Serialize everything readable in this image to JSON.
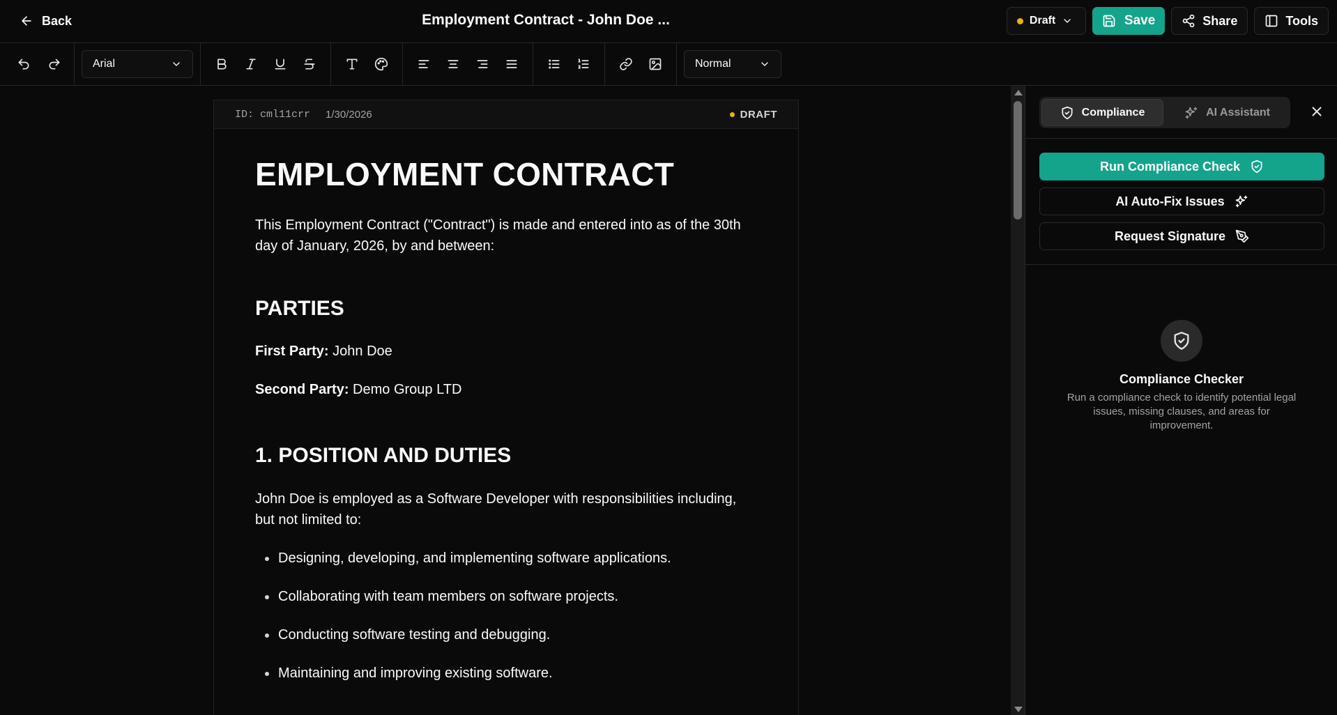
{
  "header": {
    "back_label": "Back",
    "title": "Employment Contract - John Doe ...",
    "status_label": "Draft",
    "save_label": "Save",
    "share_label": "Share",
    "tools_label": "Tools",
    "status_color": "#eab308",
    "accent_color": "#14a38b"
  },
  "toolbar": {
    "font_family": "Arial",
    "block_style": "Normal",
    "icons": [
      "undo-icon",
      "redo-icon",
      "bold-icon",
      "italic-icon",
      "underline-icon",
      "strikethrough-icon",
      "text-type-icon",
      "palette-icon",
      "align-left-icon",
      "align-center-icon",
      "align-right-icon",
      "align-justify-icon",
      "bullet-list-icon",
      "numbered-list-icon",
      "link-icon",
      "image-icon"
    ]
  },
  "document": {
    "id": "ID: cml11crr",
    "date": "1/30/2026",
    "status_badge": "DRAFT",
    "heading": "EMPLOYMENT CONTRACT",
    "intro": "This Employment Contract (\"Contract\") is made and entered into as of the 30th day of January, 2026, by and between:",
    "parties_heading": "PARTIES",
    "first_party_label": "First Party:",
    "first_party_value": " John Doe",
    "second_party_label": "Second Party:",
    "second_party_value": " Demo Group LTD",
    "section1_heading": "1. POSITION AND DUTIES",
    "section1_text": "John Doe is employed as a Software Developer with responsibilities including, but not limited to:",
    "duties": [
      "Designing, developing, and implementing software applications.",
      "Collaborating with team members on software projects.",
      "Conducting software testing and debugging.",
      "Maintaining and improving existing software."
    ]
  },
  "panel": {
    "tab_compliance": "Compliance",
    "tab_ai": "AI Assistant",
    "run_check": "Run Compliance Check",
    "auto_fix": "AI Auto-Fix Issues",
    "request_signature": "Request Signature",
    "empty_title": "Compliance Checker",
    "empty_desc": "Run a compliance check to identify potential legal issues, missing clauses, and areas for improvement."
  }
}
